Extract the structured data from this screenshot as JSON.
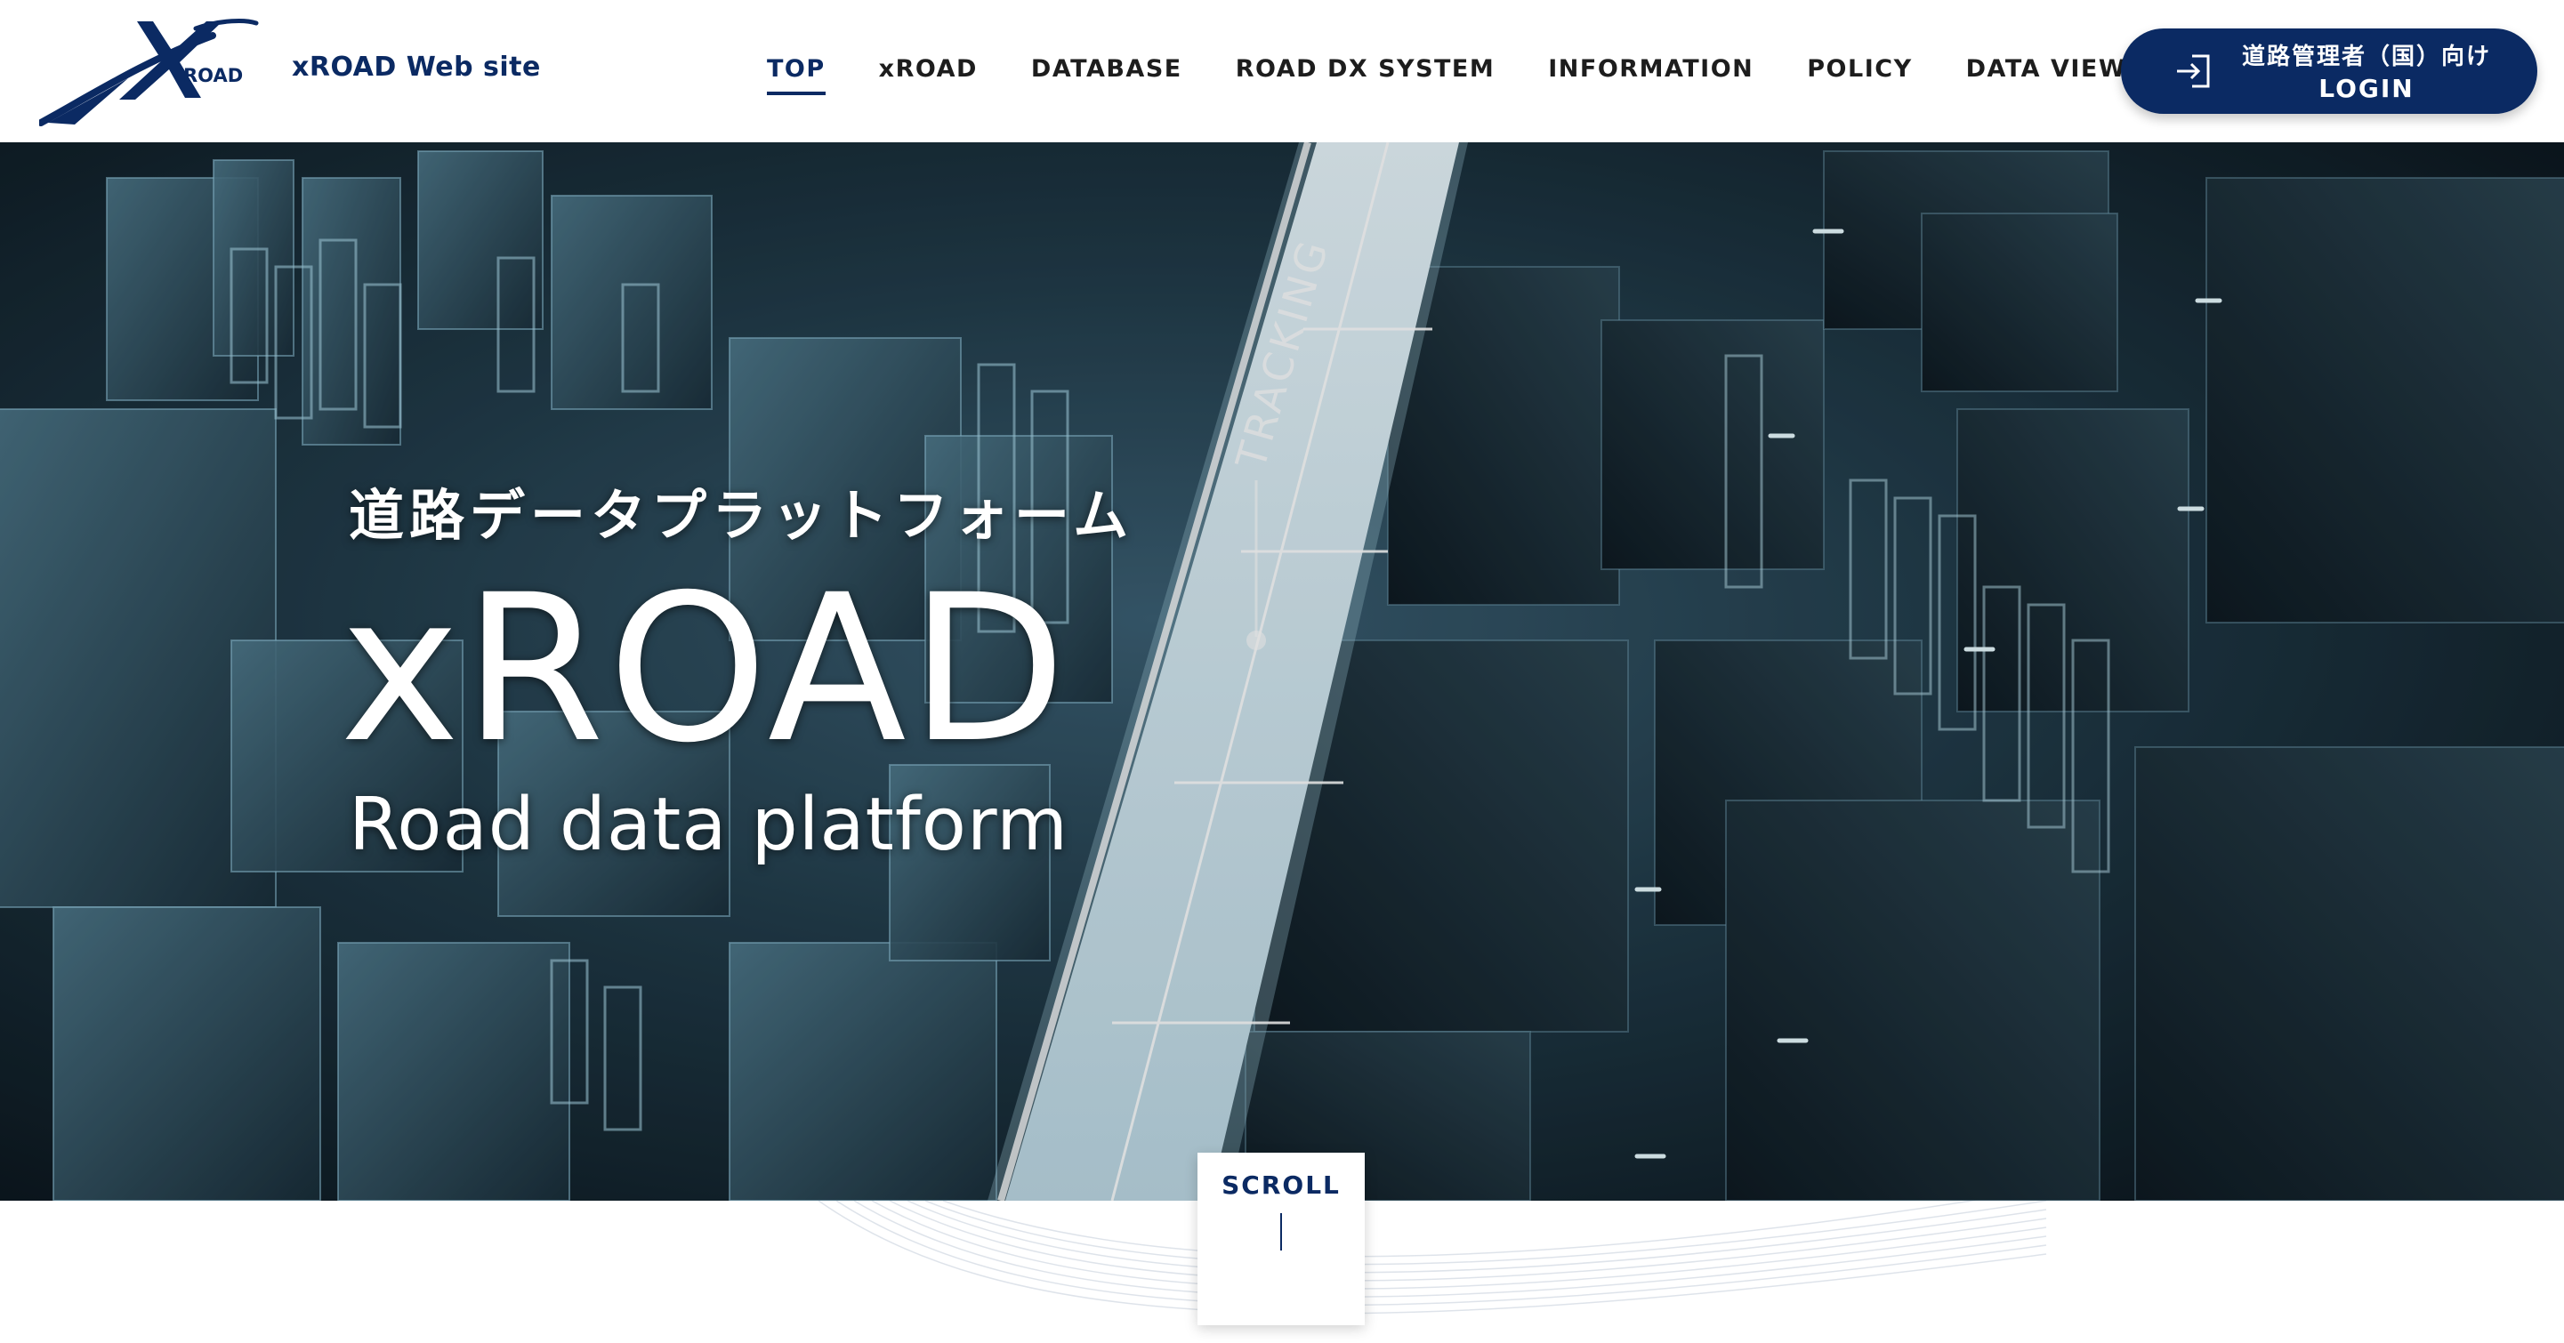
{
  "header": {
    "logo_text": "ROAD",
    "site_name": "xROAD Web site",
    "nav": [
      {
        "label": "TOP",
        "active": true
      },
      {
        "label": "xROAD"
      },
      {
        "label": "DATABASE"
      },
      {
        "label": "ROAD DX SYSTEM"
      },
      {
        "label": "INFORMATION"
      },
      {
        "label": "POLICY"
      },
      {
        "label": "DATA VIEWER",
        "has_dropdown": true
      }
    ],
    "login": {
      "line1": "道路管理者（国）向け",
      "line2": "LOGIN",
      "icon": "login-icon"
    }
  },
  "hero": {
    "subtitle_jp": "道路データプラットフォーム",
    "title": "xROAD",
    "subtitle_en": "Road data platform",
    "road_label": "TRACKING"
  },
  "scroll": {
    "label": "SCROLL"
  },
  "colors": {
    "brand_navy": "#0b2a63",
    "nav_text": "#1d1d1d",
    "hero_bg": "#0b161e"
  }
}
